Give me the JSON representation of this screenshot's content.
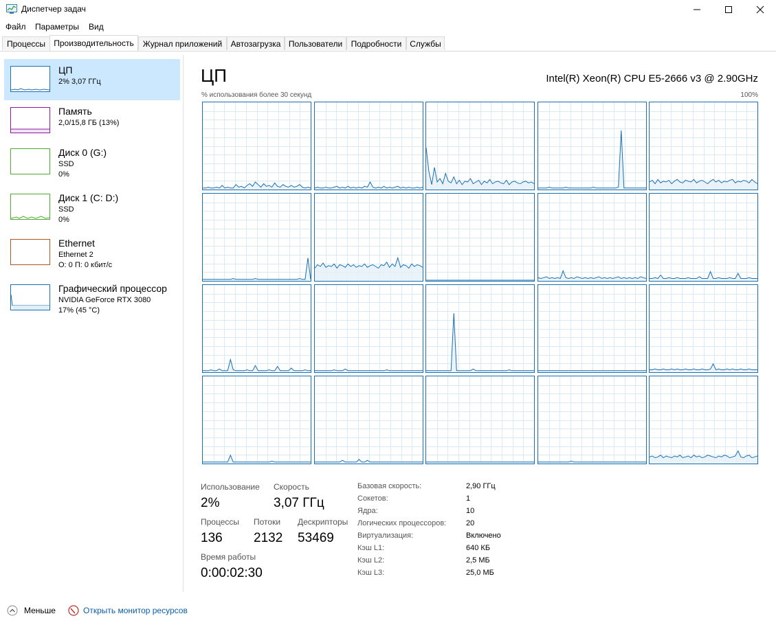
{
  "window": {
    "title": "Диспетчер задач"
  },
  "menu": [
    "Файл",
    "Параметры",
    "Вид"
  ],
  "tabs": [
    {
      "label": "Процессы",
      "active": false
    },
    {
      "label": "Производительность",
      "active": true
    },
    {
      "label": "Журнал приложений",
      "active": false
    },
    {
      "label": "Автозагрузка",
      "active": false
    },
    {
      "label": "Пользователи",
      "active": false
    },
    {
      "label": "Подробности",
      "active": false
    },
    {
      "label": "Службы",
      "active": false
    }
  ],
  "sidebar": [
    {
      "title": "ЦП",
      "sub1": "2% 3,07 ГГц",
      "sub2": "",
      "sub3": "",
      "color": "#1a6fb0"
    },
    {
      "title": "Память",
      "sub1": "2,0/15,8 ГБ (13%)",
      "sub2": "",
      "sub3": "",
      "color": "#8b1aa0"
    },
    {
      "title": "Диск 0 (G:)",
      "sub1": "SSD",
      "sub2": "0%",
      "sub3": "",
      "color": "#4ea72e"
    },
    {
      "title": "Диск 1 (C: D:)",
      "sub1": "SSD",
      "sub2": "0%",
      "sub3": "",
      "color": "#4ea72e"
    },
    {
      "title": "Ethernet",
      "sub1": "Ethernet 2",
      "sub2": "О: 0 П: 0 кбит/с",
      "sub3": "",
      "color": "#a8581a"
    },
    {
      "title": "Графический процессор",
      "sub1": "NVIDIA GeForce RTX 3080",
      "sub2": "17% (45 °C)",
      "sub3": "",
      "color": "#1a6fb0"
    }
  ],
  "main": {
    "title": "ЦП",
    "cpu_name": "Intel(R) Xeon(R) CPU E5-2666 v3 @ 2.90GHz",
    "graph_caption": "% использования более 30 секунд",
    "graph_max": "100%",
    "accent": "#1a6fb0",
    "stats": {
      "usage_label": "Использование",
      "usage_value": "2%",
      "speed_label": "Скорость",
      "speed_value": "3,07 ГГц",
      "proc_label": "Процессы",
      "proc_value": "136",
      "threads_label": "Потоки",
      "threads_value": "2132",
      "handles_label": "Дескрипторы",
      "handles_value": "53469",
      "uptime_label": "Время работы",
      "uptime_value": "0:00:02:30"
    },
    "details": [
      {
        "label": "Базовая скорость:",
        "value": "2,90 ГГц"
      },
      {
        "label": "Сокетов:",
        "value": "1"
      },
      {
        "label": "Ядра:",
        "value": "10"
      },
      {
        "label": "Логических процессоров:",
        "value": "20"
      },
      {
        "label": "Виртуализация:",
        "value": "Включено"
      },
      {
        "label": "Кэш L1:",
        "value": "640 КБ"
      },
      {
        "label": "Кэш L2:",
        "value": "2,5 МБ"
      },
      {
        "label": "Кэш L3:",
        "value": "25,0 МБ"
      }
    ],
    "cores": [
      {
        "u": [
          1,
          1,
          2,
          1,
          1,
          2,
          1,
          4,
          1,
          2,
          1,
          1,
          5,
          2,
          3,
          1,
          4,
          6,
          3,
          8,
          5,
          2,
          6,
          3,
          4,
          2,
          7,
          3,
          2,
          5,
          3,
          2,
          4,
          2,
          3,
          5,
          2,
          1,
          2,
          1
        ]
      },
      {
        "u": [
          1,
          2,
          1,
          1,
          2,
          1,
          1,
          2,
          3,
          1,
          2,
          1,
          3,
          1,
          2,
          1,
          2,
          1,
          3,
          2,
          8,
          2,
          1,
          2,
          1,
          3,
          1,
          2,
          1,
          2,
          3,
          1,
          2,
          1,
          2,
          1,
          1,
          2,
          1,
          2
        ]
      },
      {
        "u": [
          48,
          20,
          5,
          25,
          8,
          12,
          6,
          18,
          9,
          7,
          14,
          6,
          10,
          5,
          9,
          8,
          12,
          6,
          8,
          10,
          5,
          9,
          7,
          11,
          6,
          8,
          9,
          7,
          6,
          10,
          5,
          8,
          9,
          7,
          6,
          8,
          9,
          7,
          8,
          6
        ]
      },
      {
        "u": [
          1,
          1,
          1,
          1,
          2,
          1,
          1,
          1,
          1,
          1,
          2,
          1,
          1,
          1,
          1,
          1,
          1,
          1,
          1,
          1,
          2,
          1,
          1,
          1,
          1,
          1,
          1,
          1,
          1,
          2,
          68,
          1,
          1,
          1,
          1,
          1,
          1,
          1,
          1,
          1
        ]
      },
      {
        "u": [
          8,
          10,
          6,
          11,
          7,
          9,
          8,
          10,
          6,
          9,
          11,
          8,
          7,
          10,
          9,
          8,
          11,
          7,
          9,
          10,
          8,
          6,
          9,
          11,
          8,
          10,
          7,
          9,
          8,
          10,
          11,
          7,
          9,
          8,
          10,
          9,
          7,
          11,
          8,
          6
        ]
      },
      {
        "u": [
          1,
          1,
          1,
          1,
          1,
          1,
          1,
          1,
          1,
          1,
          1,
          2,
          1,
          1,
          1,
          1,
          1,
          1,
          1,
          2,
          1,
          1,
          1,
          1,
          1,
          1,
          1,
          1,
          1,
          1,
          1,
          1,
          1,
          1,
          1,
          2,
          1,
          1,
          26,
          1
        ]
      },
      {
        "u": [
          14,
          18,
          16,
          20,
          15,
          17,
          16,
          19,
          14,
          18,
          17,
          15,
          19,
          16,
          18,
          15,
          17,
          16,
          19,
          15,
          17,
          18,
          16,
          14,
          18,
          17,
          21,
          15,
          19,
          16,
          26,
          15,
          18,
          17,
          14,
          19,
          16,
          18,
          17,
          15
        ]
      },
      {
        "u": [
          0,
          0,
          0,
          0,
          0,
          0,
          0,
          0,
          0,
          0,
          0,
          0,
          0,
          0,
          0,
          0,
          0,
          0,
          0,
          0,
          0,
          0,
          0,
          0,
          0,
          0,
          0,
          0,
          0,
          0,
          0,
          0,
          0,
          0,
          0,
          0,
          0,
          0,
          0,
          0
        ]
      },
      {
        "u": [
          3,
          2,
          3,
          4,
          2,
          3,
          2,
          3,
          2,
          11,
          3,
          2,
          3,
          2,
          4,
          3,
          2,
          3,
          2,
          3,
          2,
          3,
          4,
          2,
          3,
          2,
          3,
          2,
          3,
          4,
          2,
          3,
          2,
          3,
          2,
          3,
          2,
          4,
          3,
          2
        ]
      },
      {
        "u": [
          2,
          2,
          3,
          2,
          6,
          2,
          2,
          3,
          2,
          2,
          3,
          2,
          2,
          2,
          3,
          2,
          2,
          2,
          4,
          2,
          2,
          2,
          10,
          2,
          2,
          3,
          2,
          2,
          2,
          3,
          2,
          2,
          8,
          2,
          2,
          2,
          3,
          2,
          2,
          2
        ]
      },
      {
        "u": [
          1,
          1,
          1,
          2,
          1,
          1,
          3,
          1,
          1,
          1,
          14,
          2,
          1,
          1,
          1,
          1,
          2,
          1,
          1,
          7,
          1,
          1,
          1,
          1,
          2,
          1,
          1,
          6,
          1,
          1,
          1,
          1,
          4,
          1,
          1,
          1,
          1,
          2,
          1,
          1
        ]
      },
      {
        "u": [
          1,
          1,
          1,
          1,
          1,
          1,
          1,
          2,
          1,
          1,
          1,
          3,
          1,
          1,
          1,
          1,
          1,
          1,
          1,
          1,
          1,
          1,
          1,
          1,
          1,
          1,
          2,
          1,
          1,
          1,
          1,
          1,
          1,
          1,
          1,
          1,
          1,
          1,
          1,
          1
        ]
      },
      {
        "u": [
          1,
          1,
          1,
          1,
          1,
          1,
          1,
          1,
          1,
          1,
          68,
          1,
          1,
          1,
          1,
          1,
          1,
          3,
          1,
          1,
          1,
          1,
          1,
          1,
          1,
          1,
          1,
          1,
          1,
          1,
          2,
          1,
          1,
          1,
          1,
          1,
          1,
          1,
          1,
          1
        ]
      },
      {
        "u": [
          1,
          1,
          1,
          1,
          1,
          1,
          1,
          1,
          1,
          1,
          1,
          1,
          1,
          1,
          1,
          1,
          1,
          1,
          1,
          1,
          1,
          1,
          1,
          1,
          1,
          1,
          1,
          1,
          1,
          1,
          1,
          1,
          1,
          1,
          1,
          1,
          1,
          1,
          1,
          1
        ]
      },
      {
        "u": [
          2,
          2,
          3,
          2,
          2,
          3,
          2,
          2,
          3,
          2,
          3,
          2,
          2,
          3,
          2,
          2,
          3,
          2,
          2,
          3,
          2,
          2,
          3,
          9,
          2,
          3,
          2,
          2,
          3,
          2,
          3,
          2,
          2,
          3,
          2,
          2,
          3,
          2,
          2,
          2
        ]
      },
      {
        "u": [
          1,
          1,
          1,
          1,
          1,
          1,
          1,
          1,
          1,
          1,
          9,
          1,
          1,
          1,
          1,
          1,
          1,
          1,
          1,
          1,
          1,
          1,
          1,
          1,
          1,
          2,
          1,
          1,
          1,
          1,
          1,
          1,
          1,
          1,
          1,
          1,
          1,
          1,
          1,
          1
        ]
      },
      {
        "u": [
          1,
          1,
          1,
          1,
          1,
          1,
          1,
          1,
          1,
          1,
          3,
          1,
          1,
          1,
          1,
          1,
          4,
          1,
          1,
          3,
          1,
          1,
          1,
          1,
          1,
          1,
          1,
          1,
          1,
          1,
          1,
          1,
          1,
          1,
          1,
          1,
          1,
          1,
          1,
          1
        ]
      },
      {
        "u": [
          1,
          1,
          1,
          1,
          1,
          1,
          1,
          1,
          1,
          1,
          1,
          1,
          1,
          1,
          1,
          1,
          1,
          1,
          1,
          1,
          1,
          1,
          1,
          1,
          1,
          1,
          1,
          1,
          1,
          1,
          1,
          1,
          1,
          1,
          1,
          1,
          1,
          1,
          1,
          1
        ]
      },
      {
        "u": [
          1,
          1,
          1,
          1,
          1,
          1,
          1,
          1,
          1,
          1,
          1,
          1,
          2,
          1,
          1,
          1,
          1,
          1,
          1,
          1,
          1,
          1,
          1,
          1,
          1,
          1,
          1,
          1,
          1,
          1,
          1,
          1,
          1,
          1,
          1,
          1,
          1,
          1,
          1,
          1
        ]
      },
      {
        "u": [
          7,
          8,
          6,
          7,
          9,
          6,
          8,
          7,
          6,
          8,
          7,
          9,
          6,
          7,
          8,
          6,
          9,
          7,
          8,
          6,
          7,
          9,
          8,
          7,
          6,
          8,
          7,
          9,
          8,
          6,
          7,
          8,
          14,
          7,
          6,
          8,
          9,
          6,
          7,
          8
        ]
      }
    ]
  },
  "footer": {
    "less_label": "Меньше",
    "link_label": "Открыть монитор ресурсов"
  }
}
